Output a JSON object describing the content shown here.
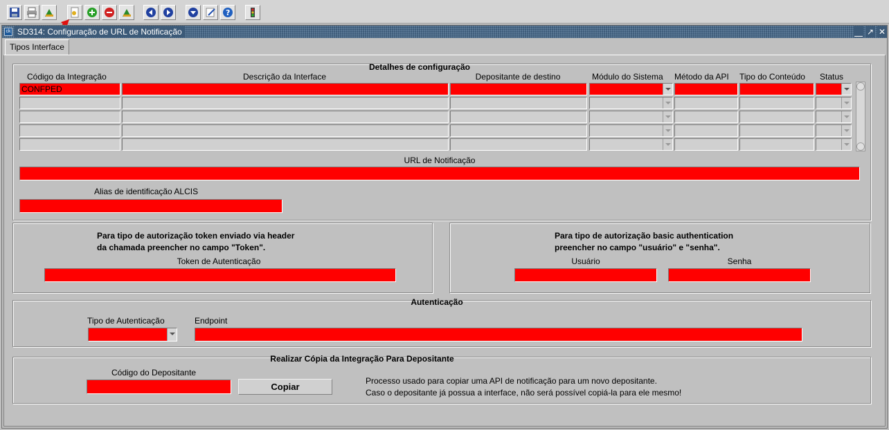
{
  "window": {
    "title": "SD314: Configuração de URL de Notificação",
    "icon": "app-icon"
  },
  "toolbar": {
    "buttons": [
      "save-icon",
      "print-icon",
      "exit-icon",
      "new-doc-icon",
      "add-icon",
      "remove-icon",
      "exit2-icon",
      "first-icon",
      "next-icon",
      "down-icon",
      "edit-icon",
      "help-icon",
      "traffic-light-icon"
    ]
  },
  "tabs": [
    {
      "label": "Tipos Interface"
    }
  ],
  "detalhes": {
    "title": "Detalhes de configuração",
    "columns": [
      "Código da Integração",
      "Descrição da Interface",
      "Depositante de destino",
      "Módulo do Sistema",
      "Método da API",
      "Tipo do Conteúdo",
      "Status"
    ],
    "rows": [
      {
        "codigo": "CONFPED",
        "descricao": "",
        "depositante": "",
        "modulo": "",
        "metodo": "",
        "tipo": "",
        "status": ""
      },
      {
        "codigo": "",
        "descricao": "",
        "depositante": "",
        "modulo": "",
        "metodo": "",
        "tipo": "",
        "status": ""
      },
      {
        "codigo": "",
        "descricao": "",
        "depositante": "",
        "modulo": "",
        "metodo": "",
        "tipo": "",
        "status": ""
      },
      {
        "codigo": "",
        "descricao": "",
        "depositante": "",
        "modulo": "",
        "metodo": "",
        "tipo": "",
        "status": ""
      },
      {
        "codigo": "",
        "descricao": "",
        "depositante": "",
        "modulo": "",
        "metodo": "",
        "tipo": "",
        "status": ""
      }
    ],
    "url_label": "URL de Notificação",
    "url_value": "",
    "alias_label": "Alias de identificação ALCIS",
    "alias_value": ""
  },
  "token_panel": {
    "line1": "Para tipo de autorização token enviado via header",
    "line2": "da chamada preencher no campo \"Token\".",
    "token_label": "Token de Autenticação",
    "token_value": ""
  },
  "basic_panel": {
    "line1": "Para tipo de autorização basic authentication",
    "line2": "preencher no campo \"usuário\" e \"senha\".",
    "user_label": "Usuário",
    "user_value": "",
    "pass_label": "Senha",
    "pass_value": ""
  },
  "autenticacao": {
    "title": "Autenticação",
    "tipo_label": "Tipo de Autenticação",
    "tipo_value": "",
    "endpoint_label": "Endpoint",
    "endpoint_value": ""
  },
  "copia": {
    "title": "Realizar Cópia da Integração Para Depositante",
    "codigo_label": "Código do Depositante",
    "codigo_value": "",
    "button_label": "Copiar",
    "note1": "Processo usado para copiar uma API de notificação para um novo depositante.",
    "note2": "Caso o depositante já possua a interface, não será possível copiá-la para ele mesmo!"
  }
}
